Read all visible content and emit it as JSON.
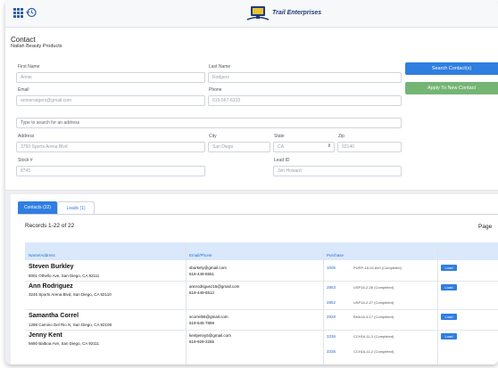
{
  "header": {
    "brand": "Trail Enterprises"
  },
  "contact_panel": {
    "title": "Contact",
    "subtitle": "Nailah Beauty Products",
    "fields": {
      "first_name": {
        "label": "First Name",
        "value": "Annie"
      },
      "last_name": {
        "label": "Last Name",
        "value": "Rodgers"
      },
      "email": {
        "label": "Email",
        "value": "annierodgers@gmail.com"
      },
      "phone": {
        "label": "Phone",
        "value": "619-567-6333"
      },
      "address_search": {
        "placeholder": "Type to search for an address"
      },
      "address": {
        "label": "Address",
        "value": "3750 Sports Arena Blvd"
      },
      "city": {
        "label": "City",
        "value": "San Diego"
      },
      "state": {
        "label": "State",
        "value": "CA"
      },
      "zip": {
        "label": "Zip",
        "value": "92140"
      },
      "stock": {
        "label": "Stock #",
        "value": "8745"
      },
      "lead_id": {
        "label": "Lead ID",
        "value": "Jen Howard"
      }
    },
    "buttons": {
      "search": "Search Contact(s)",
      "apply": "Apply To New Contact"
    }
  },
  "results": {
    "tabs": [
      {
        "label": "Contacts (22)",
        "active": true
      },
      {
        "label": "Leads (1)",
        "active": false
      }
    ],
    "records_text": "Records 1-22 of 22",
    "page_label": "Page",
    "columns": [
      "Name/Address",
      "Email/Phone",
      "Purchase"
    ],
    "rows": [
      {
        "name": "Steven Burkley",
        "address": "8001 Othello Ave, San Diego, CA 92111",
        "email": "sburkely@gmail.com",
        "phone": "619-449-6551",
        "purchases": [
          {
            "id": "1005",
            "desc": "PURP-18-02-849 (Completed)"
          }
        ],
        "load_label": "Load"
      },
      {
        "name": "Ann Rodriguez",
        "address": "3245 Sports Arena Blvd, San Diego, CA 92110",
        "email": "annrodriguez15@gmail.com",
        "phone": "619-449-6512",
        "purchases": [
          {
            "id": "2853",
            "desc": "USP16-2-26 (Completed)"
          },
          {
            "id": "2852",
            "desc": "USP16-2-27 (Completed)"
          }
        ],
        "load_label": "Load"
      },
      {
        "name": "Samantha Correl",
        "address": "1288 Camino Del Rio N, San Diego, CA 92108",
        "email": "scorrel56@gmail.com",
        "phone": "619-545-7869",
        "purchases": [
          {
            "id": "2828",
            "desc": "BHA16-4-17 (Completed)"
          }
        ],
        "load_label": "Load"
      },
      {
        "name": "Jenny Kent",
        "address": "5680 Balboa Ave, San Diego, CA 92111",
        "email": "kentjenny5@gmail.com",
        "phone": "619-929-2255",
        "purchases": [
          {
            "id": "3336",
            "desc": "CCH16-11-3 (Completed)"
          },
          {
            "id": "3335",
            "desc": "CCH16-11-2 (Completed)"
          }
        ],
        "load_label": "Load"
      }
    ]
  }
}
